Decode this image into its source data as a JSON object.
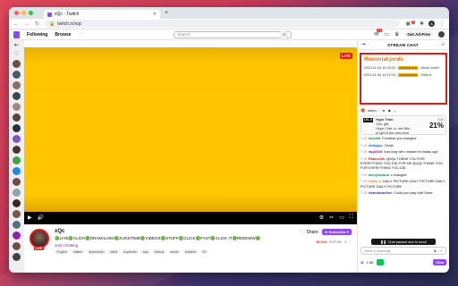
{
  "browser": {
    "tab_title": "xQc - Twitch",
    "url": "twitch.tv/xqc",
    "traffic_colors": [
      "#ff5f57",
      "#febc2e",
      "#28c840"
    ],
    "ext_badge": "8",
    "profile_initial": "A"
  },
  "topnav": {
    "following": "Following",
    "browse": "Browse",
    "more": "⋮",
    "search_placeholder": "Search",
    "notif_count": "51",
    "get_ad_free": "Get Ad-Free"
  },
  "player": {
    "live_label": "LIVE"
  },
  "stream": {
    "name": "xQc",
    "title": "🟢LIVE🟢CLICK🟢DRAMALOID🟢JUICETIME🟢VIDEOS🟢STUFF🟢CLICK🟢FAST🟢CLICK IT🟢REEEWW🟢",
    "game": "Just Chatting",
    "live_badge": "LIVE",
    "tags": [
      "English",
      "stalker",
      "depression",
      "adhd",
      "psychotic",
      "ego",
      "fanboy",
      "anime",
      "reaction",
      "Fit"
    ],
    "follow_label": "♡",
    "share_label": "Share",
    "subscribe_label": "★ Subscribe ▾",
    "viewers": "15,013",
    "uptime": "3:07:03",
    "stat_icons": "⇪ ⋮"
  },
  "chat": {
    "header_title": "STREAM CHAT",
    "memorial": {
      "title": "Memorial posts",
      "rows": [
        {
          "time": "2023-11-04 10:15:22",
          "user": "Anonymous",
          "text": "Much love!!!"
        },
        {
          "time": "2023-11-04 10:12:13",
          "user": "Anonymous",
          "text": "Hello it"
        }
      ]
    },
    "pinned_text": "talam..."
  },
  "hype": {
    "level": "LVL 8",
    "title": "Hype Train",
    "desc1": "Sub, gift,",
    "desc2": "Hype Chat, or use Bits",
    "desc3": "to get to the next level",
    "time": "2:32",
    "pct": "21%"
  },
  "messages": [
    {
      "ts": "7:15",
      "user": "luvsdia",
      "color": "#2e7d32",
      "text": "Pointless you changed"
    },
    {
      "ts": "7:15",
      "user": "mdayjuu",
      "color": "#1565c0",
      "text": "Genie"
    },
    {
      "ts": "7:15",
      "user": "mpj2019",
      "color": "#6a1b9a",
      "text": "how long will x stream for today ugh"
    },
    {
      "ts": "7:15",
      "user": "Rabox49k",
      "color": "#c62828",
      "text": "@xQc THANK YOU FOR EVERYTHING YOU DID FOR ME @xQc THANK YOU FOR EVERYTHING YOU DID"
    },
    {
      "ts": "7:15",
      "user": "itsmyviviana",
      "color": "#00838f",
      "text": "x changed"
    },
    {
      "ts": "7:15",
      "user": "Chris_L",
      "color": "#ef6c00",
      "text": "DAILY PICTURE DAILY PICTURE DAILY PICTURE DAILY PICTURE"
    },
    {
      "ts": "7:15",
      "user": "shamlavadline",
      "color": "#4527a0",
      "text": "Could you play Half Swxe"
    }
  ],
  "chat_paused": "Chat paused due to scroll",
  "chat_input_placeholder": "Send a message",
  "points": "1.6K",
  "chat_button": "Chat"
}
